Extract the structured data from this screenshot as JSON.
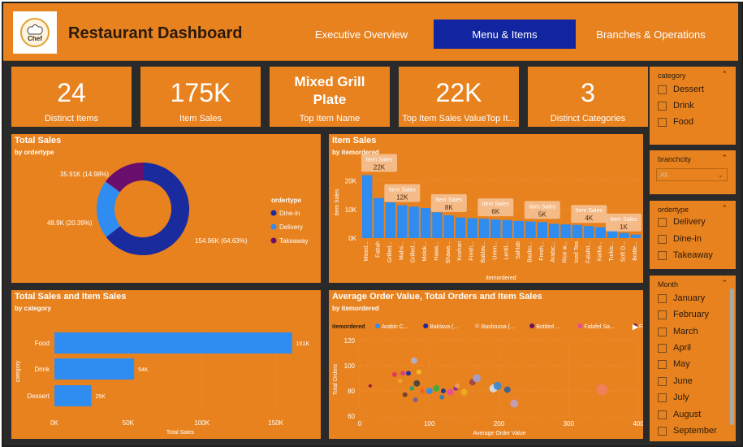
{
  "header": {
    "title": "Restaurant Dashboard",
    "logo_text": "Chef",
    "tabs": [
      {
        "label": "Executive Overview",
        "active": false
      },
      {
        "label": "Menu & Items",
        "active": true
      },
      {
        "label": "Branches & Operations",
        "active": false
      }
    ]
  },
  "kpis": [
    {
      "value": "24",
      "label": "Distinct Items"
    },
    {
      "value": "175K",
      "label": "Item Sales"
    },
    {
      "value": "Mixed Grill Plate",
      "label": "Top Item Name"
    },
    {
      "value": "22K",
      "label": "Top Item Sales ValueTop It..."
    },
    {
      "value": "3",
      "label": "Distinct Categories"
    }
  ],
  "colors": {
    "orange": "#e8821e",
    "dark_blue": "#1225a0",
    "dine_in": "#1a2b9e",
    "delivery": "#2f8cf0",
    "takeaway": "#6a0f6e"
  },
  "chart_data": [
    {
      "id": "total-sales",
      "type": "pie",
      "title": "Total Sales",
      "subtitle": "by ordertype",
      "legend_title": "ordertype",
      "legend_position": "right",
      "slices": [
        {
          "name": "Dine-in",
          "value": 154.96,
          "label": "154.96K (64.63%)",
          "color": "#1a2b9e"
        },
        {
          "name": "Delivery",
          "value": 48.9,
          "label": "48.9K (20.39%)",
          "color": "#2f8cf0"
        },
        {
          "name": "Takeaway",
          "value": 35.91,
          "label": "35.91K (14.98%)",
          "color": "#6a0f6e"
        }
      ]
    },
    {
      "id": "item-sales",
      "type": "bar",
      "title": "Item Sales",
      "subtitle": "by itemordered",
      "xlabel": "itemordered",
      "ylabel": "Item Sales",
      "ylim": [
        0,
        25000
      ],
      "yticks": [
        "0K",
        "10K",
        "20K"
      ],
      "categories": [
        "Mixed...",
        "Fattah",
        "Grilled...",
        "Mahs...",
        "Grilled...",
        "Molok...",
        "Hawa...",
        "Shawa...",
        "Koshari",
        "Fresh...",
        "Baklav...",
        "Umm...",
        "Lentil...",
        "Sahlab",
        "Basbo...",
        "Fresh...",
        "Arabic...",
        "Rice w...",
        "Iced Tea",
        "Falafel...",
        "Karka...",
        "Turkis...",
        "Soft D...",
        "Bottle..."
      ],
      "values": [
        22000,
        14000,
        12500,
        11500,
        11000,
        10500,
        9000,
        8000,
        7200,
        7000,
        6800,
        6500,
        6300,
        6000,
        5800,
        5600,
        5000,
        4800,
        4600,
        4200,
        3800,
        2800,
        1800,
        1200
      ],
      "data_labels": [
        {
          "index": 0,
          "name": "Item Sales",
          "value": "22K"
        },
        {
          "index": 3,
          "name": "Item Sales",
          "value": "12K"
        },
        {
          "index": 7,
          "name": "Item Sales",
          "value": "8K"
        },
        {
          "index": 11,
          "name": "Item Sales",
          "value": "6K"
        },
        {
          "index": 15,
          "name": "Item Sales",
          "value": "5K"
        },
        {
          "index": 19,
          "name": "Item Sales",
          "value": "4K"
        },
        {
          "index": 23,
          "name": "Item Sales",
          "value": "1K"
        }
      ]
    },
    {
      "id": "total-and-item-sales",
      "type": "bar",
      "orientation": "horizontal",
      "title": "Total Sales and Item Sales",
      "subtitle": "by category",
      "xlabel": "Total Sales",
      "ylabel": "category",
      "xlim": [
        0,
        170000
      ],
      "xticks": [
        "0K",
        "50K",
        "100K",
        "150K"
      ],
      "categories": [
        "Food",
        "Drink",
        "Dessert"
      ],
      "values": [
        161000,
        54000,
        25000
      ],
      "value_labels": [
        "161K",
        "54K",
        "25K"
      ]
    },
    {
      "id": "aov-orders",
      "type": "scatter",
      "title": "Average Order Value, Total Orders and Item Sales",
      "subtitle": "by itemordered",
      "xlabel": "Average Order Value",
      "ylabel": "Total Orders",
      "xlim": [
        0,
        400
      ],
      "ylim": [
        60,
        120
      ],
      "xticks": [
        "0",
        "100",
        "200",
        "300",
        "400"
      ],
      "yticks": [
        "60",
        "80",
        "100",
        "120"
      ],
      "legend_title": "itemordered",
      "legend": [
        {
          "name": "Arabic C...",
          "color": "#2f8cf0"
        },
        {
          "name": "Baklava (...",
          "color": "#1a2b9e"
        },
        {
          "name": "Basbousa (...",
          "color": "#f0a060"
        },
        {
          "name": "Bottled ...",
          "color": "#6a0f6e"
        },
        {
          "name": "Falafel Sa...",
          "color": "#e84aa0"
        },
        {
          "name": "Fattah",
          "color": "#6a2a5a"
        }
      ],
      "points": [
        {
          "x": 15,
          "y": 84,
          "color": "#8a1050",
          "r": 2
        },
        {
          "x": 50,
          "y": 93,
          "color": "#e03060",
          "r": 3
        },
        {
          "x": 58,
          "y": 88,
          "color": "#f0a030",
          "r": 3
        },
        {
          "x": 62,
          "y": 94,
          "color": "#d04080",
          "r": 3
        },
        {
          "x": 70,
          "y": 94,
          "color": "#1a2b9e",
          "r": 3
        },
        {
          "x": 75,
          "y": 82,
          "color": "#30a060",
          "r": 3
        },
        {
          "x": 78,
          "y": 104,
          "color": "#b0b0d0",
          "r": 4
        },
        {
          "x": 82,
          "y": 86,
          "color": "#404040",
          "r": 4
        },
        {
          "x": 85,
          "y": 95,
          "color": "#f0c020",
          "r": 3
        },
        {
          "x": 90,
          "y": 80,
          "color": "#f06020",
          "r": 3
        },
        {
          "x": 65,
          "y": 77,
          "color": "#6a3a2a",
          "r": 3
        },
        {
          "x": 80,
          "y": 73,
          "color": "#7a5a9a",
          "r": 3
        },
        {
          "x": 100,
          "y": 80,
          "color": "#2f8cf0",
          "r": 4
        },
        {
          "x": 110,
          "y": 82,
          "color": "#30b040",
          "r": 4
        },
        {
          "x": 118,
          "y": 75,
          "color": "#3a7ab0",
          "r": 3
        },
        {
          "x": 120,
          "y": 80,
          "color": "#1a2b9e",
          "r": 3
        },
        {
          "x": 130,
          "y": 79,
          "color": "#e84aa0",
          "r": 4
        },
        {
          "x": 138,
          "y": 82,
          "color": "#8a2a9a",
          "r": 3
        },
        {
          "x": 140,
          "y": 84,
          "color": "#f0a060",
          "r": 3
        },
        {
          "x": 150,
          "y": 79,
          "color": "#e8b020",
          "r": 4
        },
        {
          "x": 162,
          "y": 87,
          "color": "#a04040",
          "r": 4
        },
        {
          "x": 168,
          "y": 90,
          "color": "#a0a0d0",
          "r": 5
        },
        {
          "x": 192,
          "y": 82,
          "color": "#d0e0f0",
          "r": 5
        },
        {
          "x": 198,
          "y": 84,
          "color": "#3a8ad0",
          "r": 5
        },
        {
          "x": 212,
          "y": 81,
          "color": "#3060a0",
          "r": 4
        },
        {
          "x": 222,
          "y": 70,
          "color": "#c0a0c0",
          "r": 5
        },
        {
          "x": 348,
          "y": 81,
          "color": "#f08060",
          "r": 7
        }
      ]
    }
  ],
  "slicers": {
    "category": {
      "title": "category",
      "options": [
        "Dessert",
        "Drink",
        "Food"
      ]
    },
    "branchcity": {
      "title": "branchcity",
      "value": "All"
    },
    "ordertype": {
      "title": "ordertype",
      "options": [
        "Delivery",
        "Dine-in",
        "Takeaway"
      ]
    },
    "month": {
      "title": "Month",
      "options": [
        "January",
        "February",
        "March",
        "April",
        "May",
        "June",
        "July",
        "August",
        "September"
      ]
    }
  }
}
